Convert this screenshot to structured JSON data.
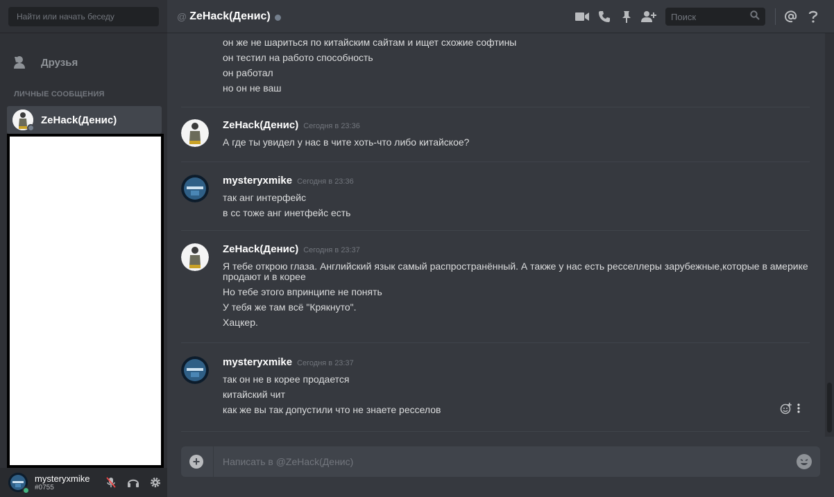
{
  "sidebar": {
    "search_placeholder": "Найти или начать беседу",
    "friends_label": "Друзья",
    "dm_header": "ЛИЧНЫЕ СООБЩЕНИЯ",
    "dm_items": [
      {
        "name": "ZeHack(Денис)",
        "status": "offline",
        "icon": "user-avatar"
      }
    ]
  },
  "user": {
    "name": "mysteryxmike",
    "tag": "#0755",
    "status": "online"
  },
  "header": {
    "at": "@",
    "channel_name": "ZeHack(Денис)",
    "search_placeholder": "Поиск",
    "icons": [
      "video-call-icon",
      "voice-call-icon",
      "pin-icon",
      "add-friend-icon",
      "search-icon",
      "mention-icon",
      "help-icon"
    ]
  },
  "messages": {
    "continuation": [
      "он же не шариться по китайским сайтам и ищет схожие софтины",
      "он тестил на работо способность",
      "он работал",
      "но он не ваш"
    ],
    "groups": [
      {
        "author": "ZeHack(Денис)",
        "time": "Сегодня в 23:36",
        "lines": [
          "А где ты увидел у нас в чите хоть-что либо  китайское?"
        ]
      },
      {
        "author": "mysteryxmike",
        "time": "Сегодня в 23:36",
        "lines": [
          "так анг интерфейс",
          "в сс тоже анг инетфейс есть"
        ]
      },
      {
        "author": "ZeHack(Денис)",
        "time": "Сегодня в 23:37",
        "lines": [
          "Я тебе открою глаза. Английский язык самый распространённый. А также у нас есть ресселлеры зарубежные,которые в америке продают и в корее",
          "Но тебе этого впринципе не понять",
          "У тебя же там всё \"Крякнуто\".",
          "Хацкер."
        ]
      },
      {
        "author": "mysteryxmike",
        "time": "Сегодня в 23:37",
        "lines": [
          "так он не в корее продается",
          "китайский чит",
          "как же вы  так допустили что не знаете ресселов"
        ]
      }
    ]
  },
  "composer": {
    "placeholder": "Написать в @ZeHack(Денис)"
  },
  "colors": {
    "bg": "#36393f",
    "sidebar": "#2f3136",
    "online": "#43b581",
    "offline": "#747f8d"
  }
}
